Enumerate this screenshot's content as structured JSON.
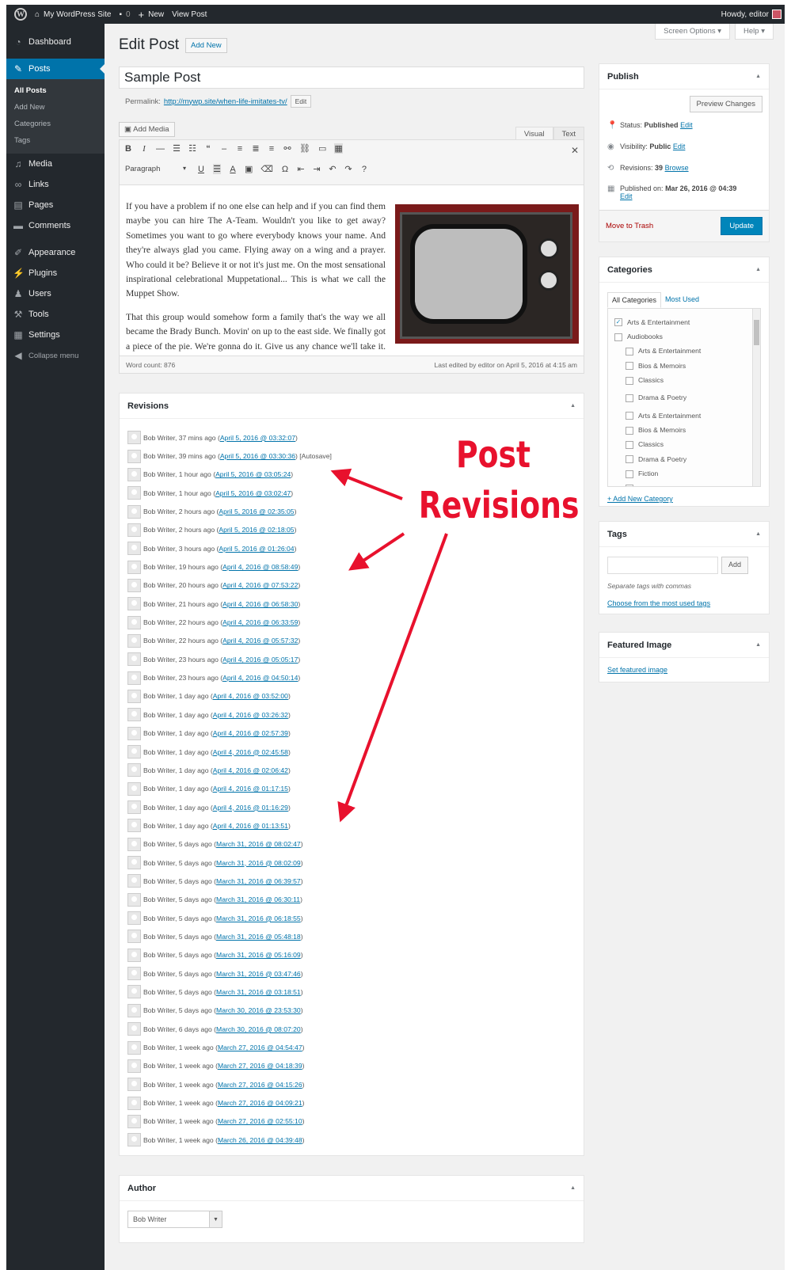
{
  "admin_bar": {
    "site_name": "My WordPress Site",
    "comments_count": "0",
    "new_label": "New",
    "view_post_label": "View Post",
    "greeting": "Howdy, editor"
  },
  "sidebar": {
    "items": [
      {
        "label": "Dashboard",
        "icon": "dashboard-icon"
      },
      {
        "label": "Posts",
        "icon": "pin-icon"
      },
      {
        "label": "Media",
        "icon": "media-icon"
      },
      {
        "label": "Links",
        "icon": "link-icon"
      },
      {
        "label": "Pages",
        "icon": "page-icon"
      },
      {
        "label": "Comments",
        "icon": "comment-icon"
      },
      {
        "label": "Appearance",
        "icon": "brush-icon"
      },
      {
        "label": "Plugins",
        "icon": "plug-icon"
      },
      {
        "label": "Users",
        "icon": "user-icon"
      },
      {
        "label": "Tools",
        "icon": "wrench-icon"
      },
      {
        "label": "Settings",
        "icon": "settings-icon"
      }
    ],
    "posts_submenu": [
      "All Posts",
      "Add New",
      "Categories",
      "Tags"
    ],
    "collapse_label": "Collapse menu"
  },
  "screen_options_label": "Screen Options",
  "help_label": "Help",
  "page": {
    "title": "Edit Post",
    "add_new_label": "Add New"
  },
  "post": {
    "title": "Sample Post",
    "permalink_label": "Permalink:",
    "permalink_url": "http://mywp.site/when-life-imitates-tv/",
    "permalink_edit": "Edit"
  },
  "editor": {
    "add_media_label": "Add Media",
    "tab_visual": "Visual",
    "tab_text": "Text",
    "format_select": "Paragraph",
    "paragraphs": [
      "If you have a problem if no one else can help and if you can find them maybe you can hire The A-Team. Wouldn't you like to get away? Sometimes you want to go where everybody knows your name. And they're always glad you came. Flying away on a wing and a prayer. Who could it be? Believe it or not it's just me. On the most sensational inspirational celebrational Muppetational... This is what we call the Muppet Show.",
      "That this group would somehow form a family that's the way we all became the Brady Bunch. Movin' on up to the east side. We finally got a piece of the pie. We're gonna do it. Give us any chance we'll take it. Give us any rule we'll break it."
    ],
    "word_count": "Word count: 876",
    "last_edited": "Last edited by editor on April 5, 2016 at 4:15 am"
  },
  "revisions": {
    "title": "Revisions",
    "items": [
      {
        "text": "Bob Writer, 37 mins ago (",
        "date": "April 5, 2016 @ 03:32:07",
        "suffix": ")"
      },
      {
        "text": "Bob Writer, 39 mins ago (",
        "date": "April 5, 2016 @ 03:30:36",
        "suffix": ") [Autosave]"
      },
      {
        "text": "Bob Writer, 1 hour ago (",
        "date": "April 5, 2016 @ 03:05:24",
        "suffix": ")"
      },
      {
        "text": "Bob Writer, 1 hour ago (",
        "date": "April 5, 2016 @ 03:02:47",
        "suffix": ")"
      },
      {
        "text": "Bob Writer, 2 hours ago (",
        "date": "April 5, 2016 @ 02:35:05",
        "suffix": ")"
      },
      {
        "text": "Bob Writer, 2 hours ago (",
        "date": "April 5, 2016 @ 02:18:05",
        "suffix": ")"
      },
      {
        "text": "Bob Writer, 3 hours ago (",
        "date": "April 5, 2016 @ 01:26:04",
        "suffix": ")"
      },
      {
        "text": "Bob Writer, 19 hours ago (",
        "date": "April 4, 2016 @ 08:58:49",
        "suffix": ")"
      },
      {
        "text": "Bob Writer, 20 hours ago (",
        "date": "April 4, 2016 @ 07:53:22",
        "suffix": ")"
      },
      {
        "text": "Bob Writer, 21 hours ago (",
        "date": "April 4, 2016 @ 06:58:30",
        "suffix": ")"
      },
      {
        "text": "Bob Writer, 22 hours ago (",
        "date": "April 4, 2016 @ 06:33:59",
        "suffix": ")"
      },
      {
        "text": "Bob Writer, 22 hours ago (",
        "date": "April 4, 2016 @ 05:57:32",
        "suffix": ")"
      },
      {
        "text": "Bob Writer, 23 hours ago (",
        "date": "April 4, 2016 @ 05:05:17",
        "suffix": ")"
      },
      {
        "text": "Bob Writer, 23 hours ago (",
        "date": "April 4, 2016 @ 04:50:14",
        "suffix": ")"
      },
      {
        "text": "Bob Writer, 1 day ago (",
        "date": "April 4, 2016 @ 03:52:00",
        "suffix": ")"
      },
      {
        "text": "Bob Writer, 1 day ago (",
        "date": "April 4, 2016 @ 03:26:32",
        "suffix": ")"
      },
      {
        "text": "Bob Writer, 1 day ago (",
        "date": "April 4, 2016 @ 02:57:39",
        "suffix": ")"
      },
      {
        "text": "Bob Writer, 1 day ago (",
        "date": "April 4, 2016 @ 02:45:58",
        "suffix": ")"
      },
      {
        "text": "Bob Writer, 1 day ago (",
        "date": "April 4, 2016 @ 02:06:42",
        "suffix": ")"
      },
      {
        "text": "Bob Writer, 1 day ago (",
        "date": "April 4, 2016 @ 01:17:15",
        "suffix": ")"
      },
      {
        "text": "Bob Writer, 1 day ago (",
        "date": "April 4, 2016 @ 01:16:29",
        "suffix": ")"
      },
      {
        "text": "Bob Writer, 1 day ago (",
        "date": "April 4, 2016 @ 01:13:51",
        "suffix": ")"
      },
      {
        "text": "Bob Writer, 5 days ago (",
        "date": "March 31, 2016 @ 08:02:47",
        "suffix": ")"
      },
      {
        "text": "Bob Writer, 5 days ago (",
        "date": "March 31, 2016 @ 08:02:09",
        "suffix": ")"
      },
      {
        "text": "Bob Writer, 5 days ago (",
        "date": "March 31, 2016 @ 06:39:57",
        "suffix": ")"
      },
      {
        "text": "Bob Writer, 5 days ago (",
        "date": "March 31, 2016 @ 06:30:11",
        "suffix": ")"
      },
      {
        "text": "Bob Writer, 5 days ago (",
        "date": "March 31, 2016 @ 06:18:55",
        "suffix": ")"
      },
      {
        "text": "Bob Writer, 5 days ago (",
        "date": "March 31, 2016 @ 05:48:18",
        "suffix": ")"
      },
      {
        "text": "Bob Writer, 5 days ago (",
        "date": "March 31, 2016 @ 05:16:09",
        "suffix": ")"
      },
      {
        "text": "Bob Writer, 5 days ago (",
        "date": "March 31, 2016 @ 03:47:46",
        "suffix": ")"
      },
      {
        "text": "Bob Writer, 5 days ago (",
        "date": "March 31, 2016 @ 03:18:51",
        "suffix": ")"
      },
      {
        "text": "Bob Writer, 5 days ago (",
        "date": "March 30, 2016 @ 23:53:30",
        "suffix": ")"
      },
      {
        "text": "Bob Writer, 6 days ago (",
        "date": "March 30, 2016 @ 08:07:20",
        "suffix": ")"
      },
      {
        "text": "Bob Writer, 1 week ago (",
        "date": "March 27, 2016 @ 04:54:47",
        "suffix": ")"
      },
      {
        "text": "Bob Writer, 1 week ago (",
        "date": "March 27, 2016 @ 04:18:39",
        "suffix": ")"
      },
      {
        "text": "Bob Writer, 1 week ago (",
        "date": "March 27, 2016 @ 04:15:26",
        "suffix": ")"
      },
      {
        "text": "Bob Writer, 1 week ago (",
        "date": "March 27, 2016 @ 04:09:21",
        "suffix": ")"
      },
      {
        "text": "Bob Writer, 1 week ago (",
        "date": "March 27, 2016 @ 02:55:10",
        "suffix": ")"
      },
      {
        "text": "Bob Writer, 1 week ago (",
        "date": "March 26, 2016 @ 04:39:48",
        "suffix": ")"
      }
    ]
  },
  "author": {
    "title": "Author",
    "selected": "Bob Writer"
  },
  "publish": {
    "title": "Publish",
    "preview_label": "Preview Changes",
    "status_label": "Status:",
    "status_value": "Published",
    "visibility_label": "Visibility:",
    "visibility_value": "Public",
    "revisions_label": "Revisions:",
    "revisions_value": "39",
    "browse_label": "Browse",
    "published_label": "Published on:",
    "published_value": "Mar 26, 2016 @ 04:39",
    "edit_label": "Edit",
    "trash_label": "Move to Trash",
    "update_label": "Update"
  },
  "categories": {
    "title": "Categories",
    "tab_all": "All Categories",
    "tab_most_used": "Most Used",
    "items": [
      {
        "label": "Arts & Entertainment",
        "checked": true
      },
      {
        "label": "Audiobooks",
        "checked": false
      },
      {
        "label": "Arts & Entertainment",
        "checked": false
      },
      {
        "label": "Bios & Memoirs",
        "checked": false
      },
      {
        "label": "Classics",
        "checked": false
      },
      {
        "label": "Drama & Poetry",
        "checked": false
      },
      {
        "label": "Arts & Entertainment",
        "checked": false
      },
      {
        "label": "Bios & Memoirs",
        "checked": false
      },
      {
        "label": "Classics",
        "checked": false
      },
      {
        "label": "Drama & Poetry",
        "checked": false
      },
      {
        "label": "Fiction",
        "checked": false
      },
      {
        "label": "Health & Fitness",
        "checked": false
      }
    ],
    "add_new_label": "+ Add New Category"
  },
  "tags": {
    "title": "Tags",
    "add_label": "Add",
    "help_text": "Separate tags with commas",
    "choose_label": "Choose from the most used tags"
  },
  "featured_image": {
    "title": "Featured Image",
    "set_label": "Set featured image"
  },
  "annotation": {
    "line1": "Post",
    "line2": "Revisions",
    "color": "#e8112d"
  }
}
